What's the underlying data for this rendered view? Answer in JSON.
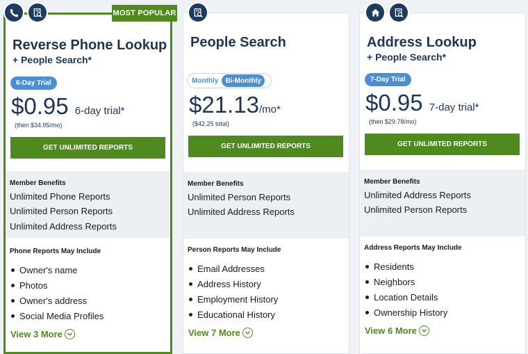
{
  "plans": [
    {
      "badge": "MOST POPULAR",
      "icons": [
        "phone-icon",
        "report-search-icon"
      ],
      "title": "Reverse Phone Lookup",
      "subtitle": "+ People Search*",
      "trial_pill": "6-Day Trial",
      "price": "$0.95",
      "price_suffix": "6-day trial*",
      "price_note": "(then $34.95/mo)",
      "cta": "GET UNLIMITED REPORTS",
      "benefits_heading": "Member Benefits",
      "benefits": [
        "Unlimited Phone Reports",
        "Unlimited Person Reports",
        "Unlimited Address Reports"
      ],
      "includes_heading": "Phone Reports May Include",
      "includes": [
        "Owner's name",
        "Photos",
        "Owner's address",
        "Social Media Profiles"
      ],
      "view_more": "View 3 More"
    },
    {
      "icons": [
        "report-search-icon"
      ],
      "title": "People Search",
      "toggle": {
        "options": [
          "Monthly",
          "Bi-Monthly"
        ],
        "selected": "Bi-Monthly"
      },
      "price": "$21.13",
      "price_suffix": "/mo*",
      "price_note": "($42.25 total)",
      "cta": "GET UNLIMITED REPORTS",
      "benefits_heading": "Member Benefits",
      "benefits": [
        "Unlimited Person Reports",
        "Unlimited Address Reports"
      ],
      "includes_heading": "Person Reports May Include",
      "includes": [
        "Email Addresses",
        "Address History",
        "Employment History",
        "Educational History"
      ],
      "view_more": "View 7 More"
    },
    {
      "icons": [
        "home-icon",
        "report-search-icon"
      ],
      "title": "Address Lookup",
      "subtitle": "+ People Search*",
      "trial_pill": "7-Day Trial",
      "price": "$0.95",
      "price_suffix": "7-day trial*",
      "price_note": "(then $29.78/mo)",
      "cta": "GET UNLIMITED REPORTS",
      "benefits_heading": "Member Benefits",
      "benefits": [
        "Unlimited Address Reports",
        "Unlimited Person Reports"
      ],
      "includes_heading": "Address Reports May Include",
      "includes": [
        "Residents",
        "Neighbors",
        "Location Details",
        "Ownership History"
      ],
      "view_more": "View 6 More"
    }
  ],
  "colors": {
    "green": "#4f8a1e",
    "navy": "#1d3557",
    "blue_pill": "#4a8fd6",
    "benefits_bg": "#ecf0f3"
  }
}
